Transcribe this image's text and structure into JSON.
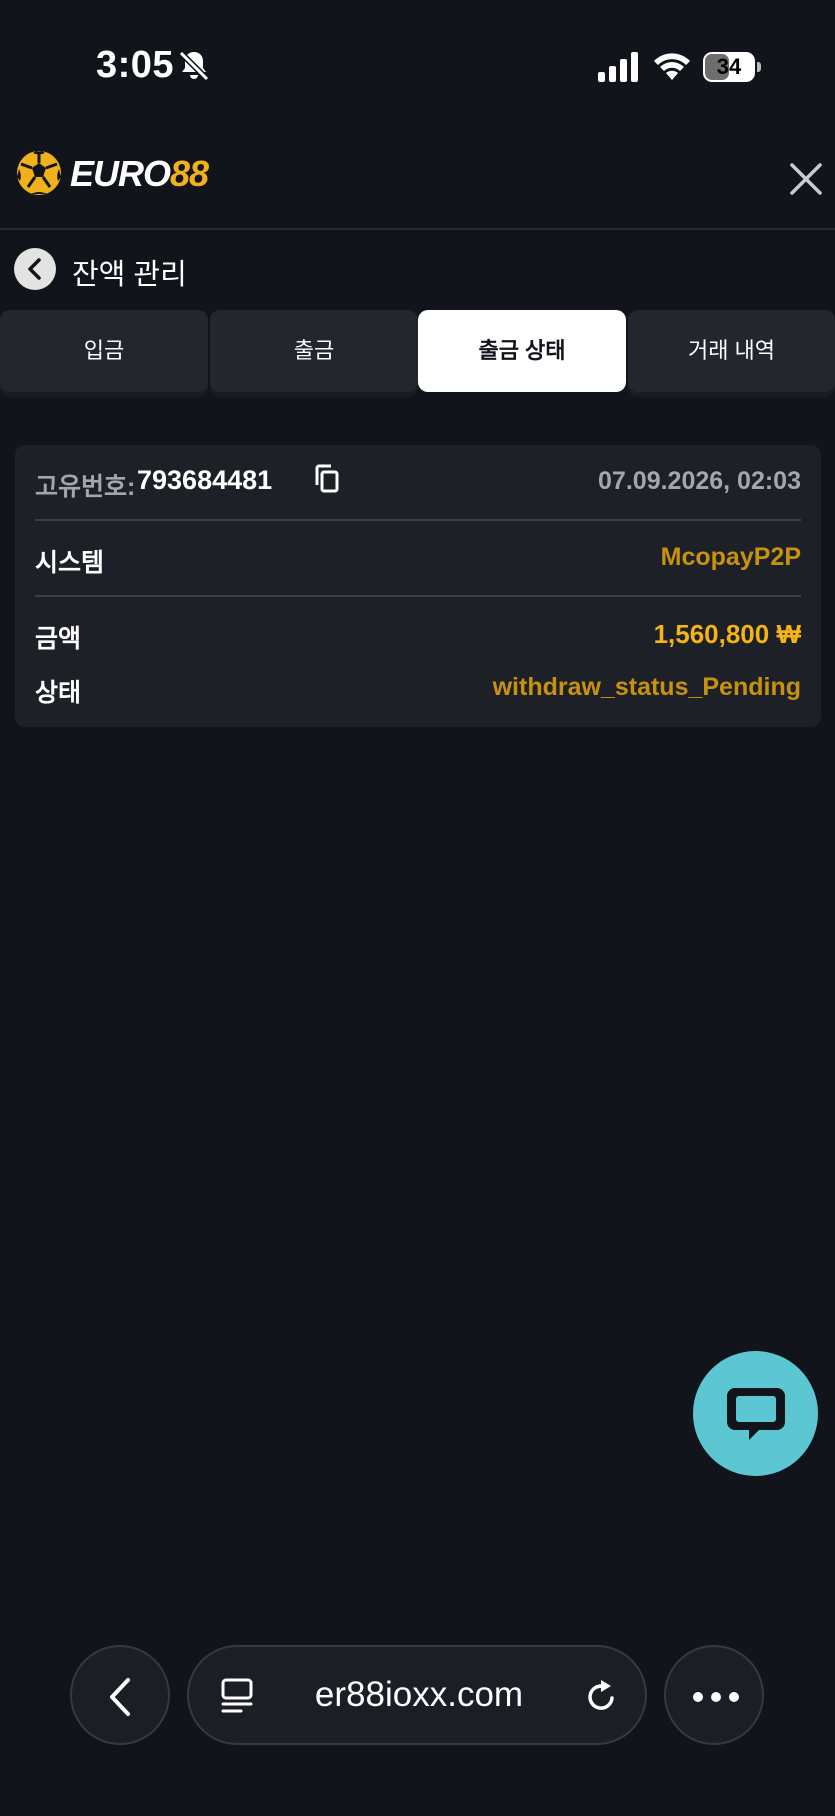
{
  "status_bar": {
    "time": "3:05",
    "battery_level": "34",
    "battery_fraction": 0.34,
    "icons": [
      "bell-slash-icon",
      "signal-icon",
      "wifi-icon",
      "battery-icon"
    ]
  },
  "header": {
    "logo_white": "EURO",
    "logo_yellow": "88",
    "icons": [
      "soccer-ball-logo-icon",
      "close-icon"
    ],
    "brand_color": "#f1b11c"
  },
  "page": {
    "title": "잔액 관리"
  },
  "tabs": [
    {
      "label": "입금",
      "active": false
    },
    {
      "label": "출금",
      "active": false
    },
    {
      "label": "출금 상태",
      "active": true
    },
    {
      "label": "거래 내역",
      "active": false
    }
  ],
  "record": {
    "id_label": "고유번호:",
    "id_value": "793684481",
    "date": "07.09.2026, 02:03",
    "system_label": "시스템",
    "system_value": "McopayP2P",
    "amount_label": "금액",
    "amount_value": "1,560,800 ₩",
    "status_label": "상태",
    "status_value": "withdraw_status_Pending"
  },
  "chat": {
    "icon": "chat-bubble-icon",
    "color": "#5cc7d3"
  },
  "browser": {
    "url": "er88ioxx.com",
    "icons": [
      "back-chevron-icon",
      "tabs-icon",
      "reload-icon",
      "more-icon"
    ]
  }
}
